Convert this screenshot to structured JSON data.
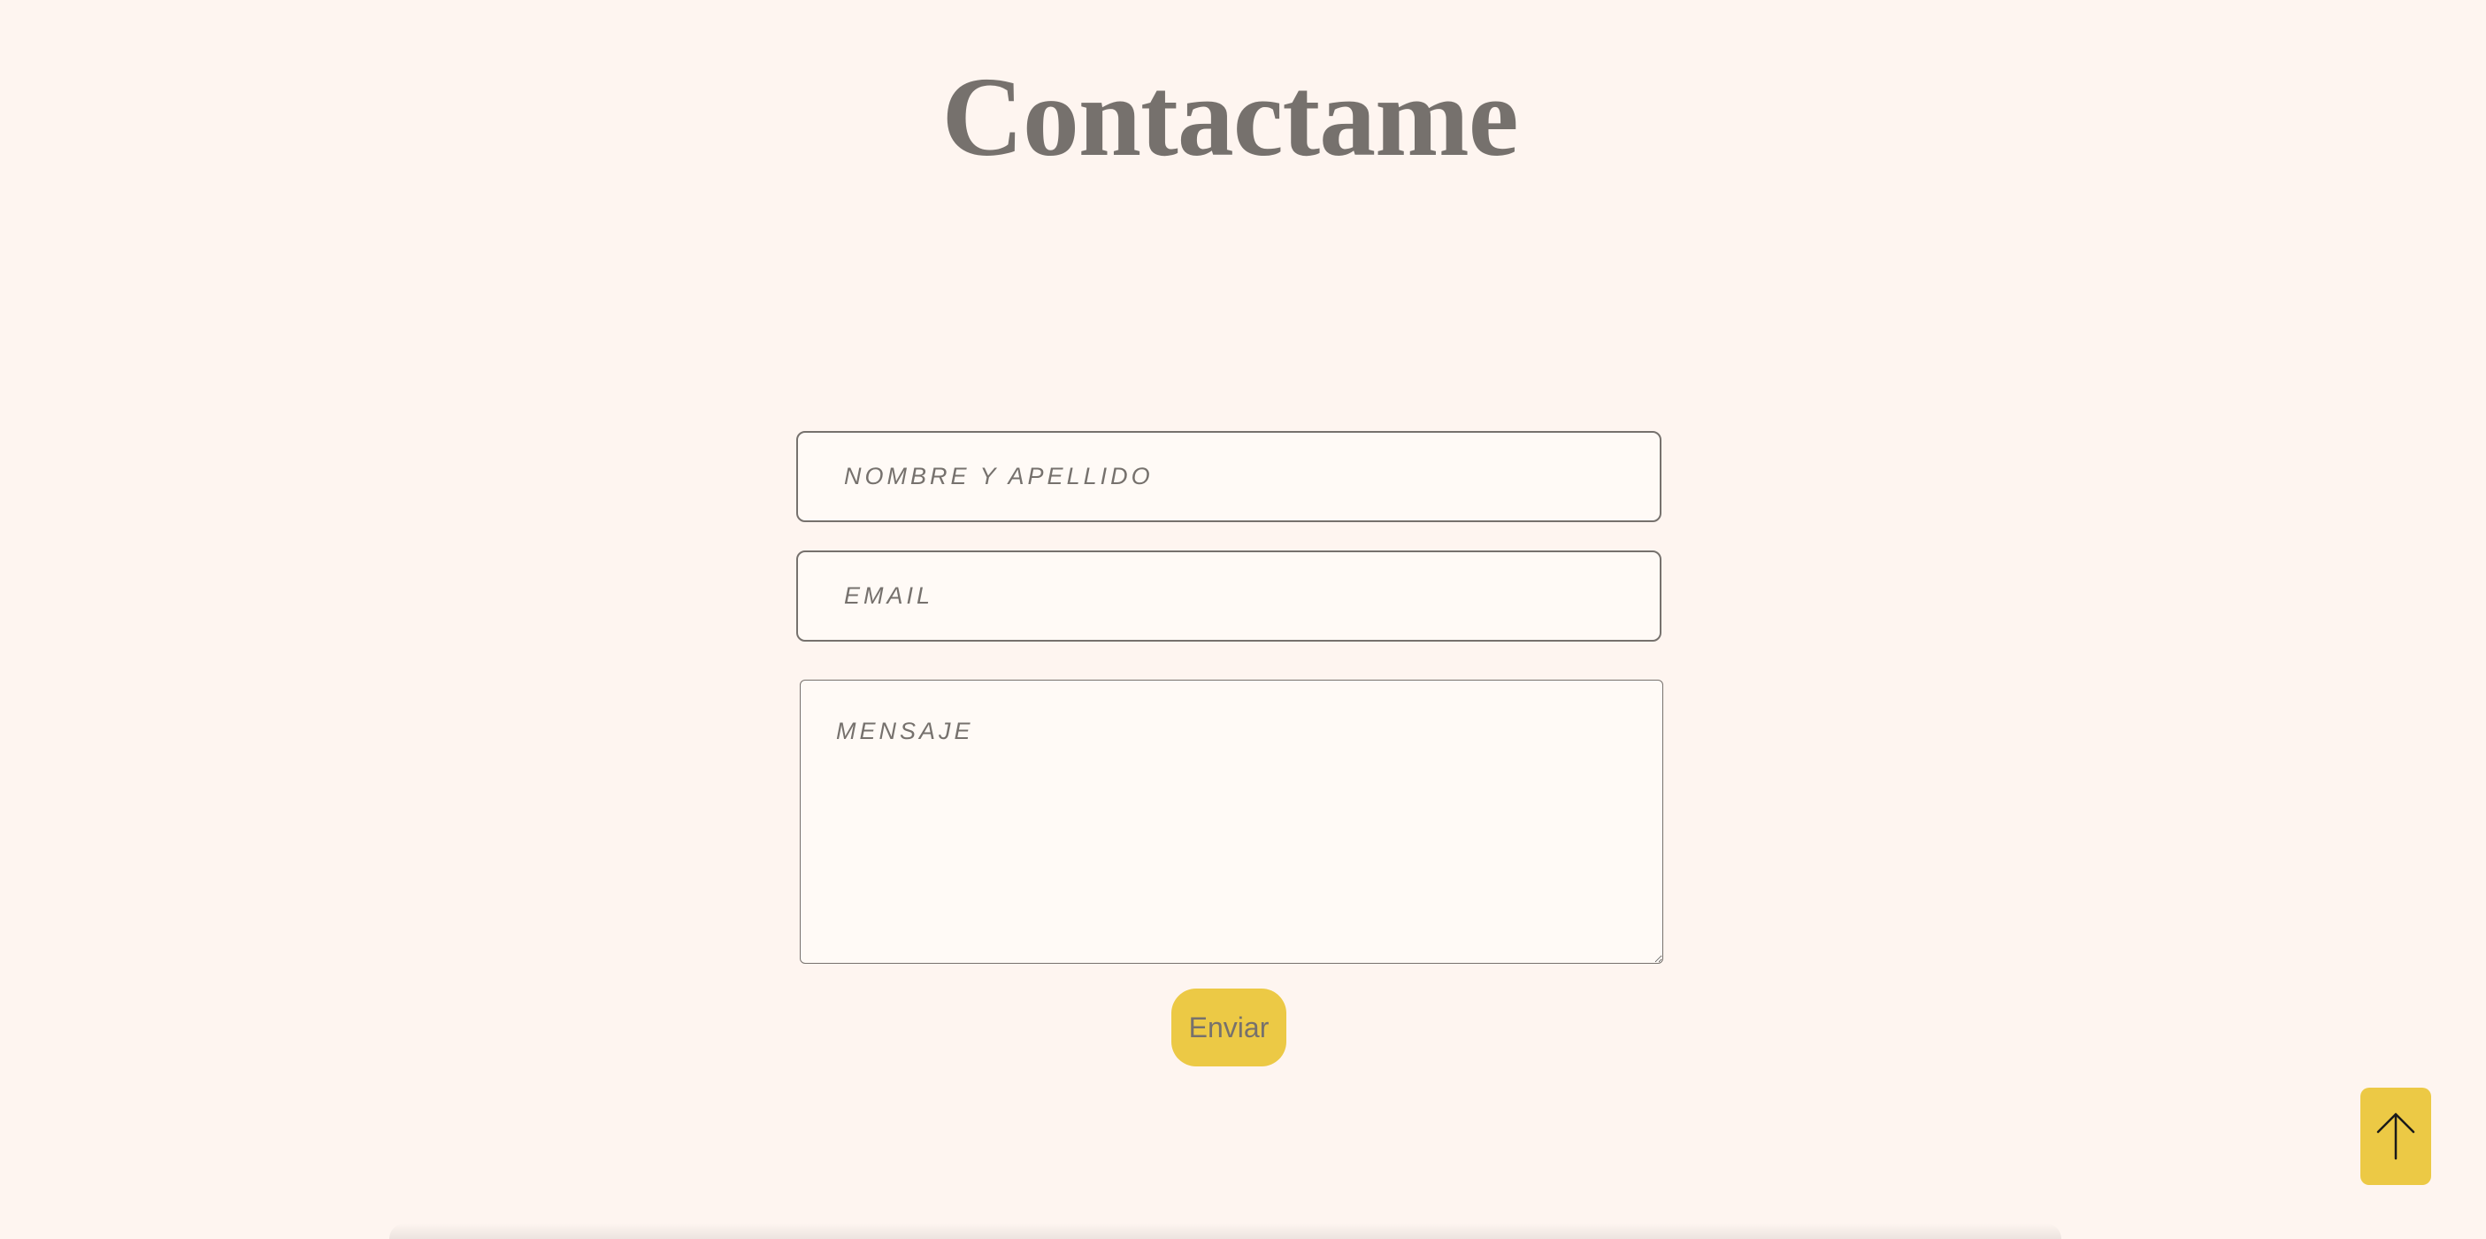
{
  "header": {
    "title": "Contactame"
  },
  "form": {
    "name_placeholder": "NOMBRE Y APELLIDO",
    "email_placeholder": "EMAIL",
    "message_placeholder": "MENSAJE",
    "submit_label": "Enviar"
  },
  "scroll_top": {
    "icon": "arrow-up-icon"
  },
  "colors": {
    "background": "#fef5f0",
    "accent": "#ecc945",
    "text": "#76716d"
  }
}
